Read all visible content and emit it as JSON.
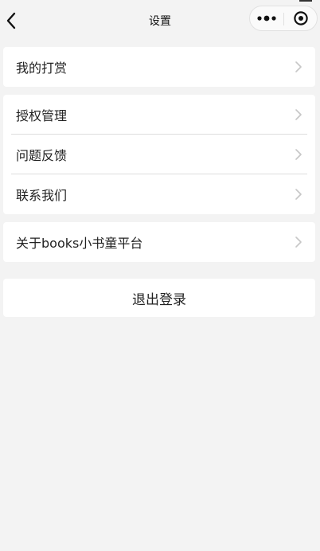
{
  "navbar": {
    "title": "设置",
    "back_icon": "chevron-left-icon",
    "more_icon": "more-dots-icon",
    "close_icon": "target-circle-icon"
  },
  "sections": [
    {
      "items": [
        {
          "label": "我的打赏"
        }
      ]
    },
    {
      "items": [
        {
          "label": "授权管理"
        },
        {
          "label": "问题反馈"
        },
        {
          "label": "联系我们"
        }
      ]
    },
    {
      "items": [
        {
          "label": "关于books小书童平台"
        }
      ]
    }
  ],
  "logout": {
    "label": "退出登录"
  },
  "colors": {
    "page_background": "#f3f3f3",
    "card_background": "#ffffff",
    "divider": "#dddddd",
    "chevron": "#c7c7c7"
  }
}
